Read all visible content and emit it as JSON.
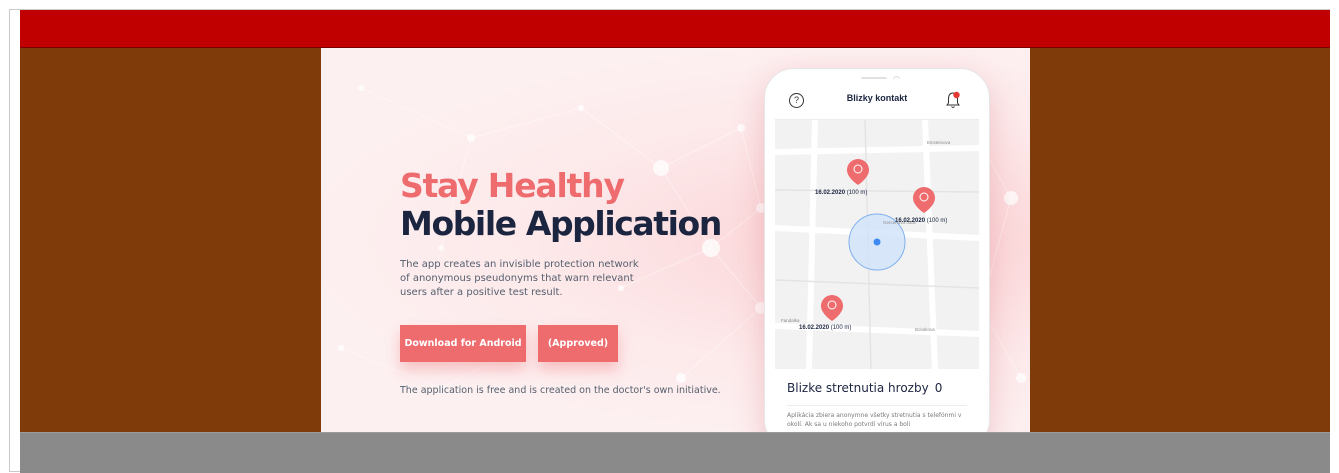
{
  "hero": {
    "title_line1": "Stay Healthy",
    "title_line2": "Mobile Application",
    "description": "The app creates an invisible protection network of anonymous pseudonyms that warn relevant users after a positive test result.",
    "free_note": "The application is free and is created on the doctor's own initiative."
  },
  "buttons": {
    "android": "Download for Android",
    "approved": "(Approved)"
  },
  "phone": {
    "header_title": "Blizky kontakt",
    "help_symbol": "?",
    "map": {
      "street_top": "Einsteinova",
      "street_mid": "Gercenova ulica",
      "street_left": "Fandalka",
      "street_bottom": "Bosakova",
      "pins": [
        {
          "date": "16.02.2020",
          "distance": "(100 m)"
        },
        {
          "date": "16.02.2020",
          "distance": "(100 m)"
        },
        {
          "date": "16.02.2020",
          "distance": "(100 m)"
        }
      ]
    },
    "card": {
      "title": "Blizke stretnutia hrozby",
      "count": "0",
      "text": "Aplikácia zbiera anonymne všetky stretnutia s telefónmi v okolí. Ak sa u niekoho potvrdí vírus a boli"
    }
  },
  "colors": {
    "top_bar": "#c00000",
    "side_band": "#7f3b0a",
    "footer": "#8a8a8a",
    "accent": "#ee6b6e",
    "navy": "#1b2540",
    "user_dot": "#3d8bf0"
  },
  "icons": {
    "help": "question-circle-icon",
    "bell": "bell-icon",
    "pin": "map-pin-icon",
    "location": "location-dot-icon"
  }
}
